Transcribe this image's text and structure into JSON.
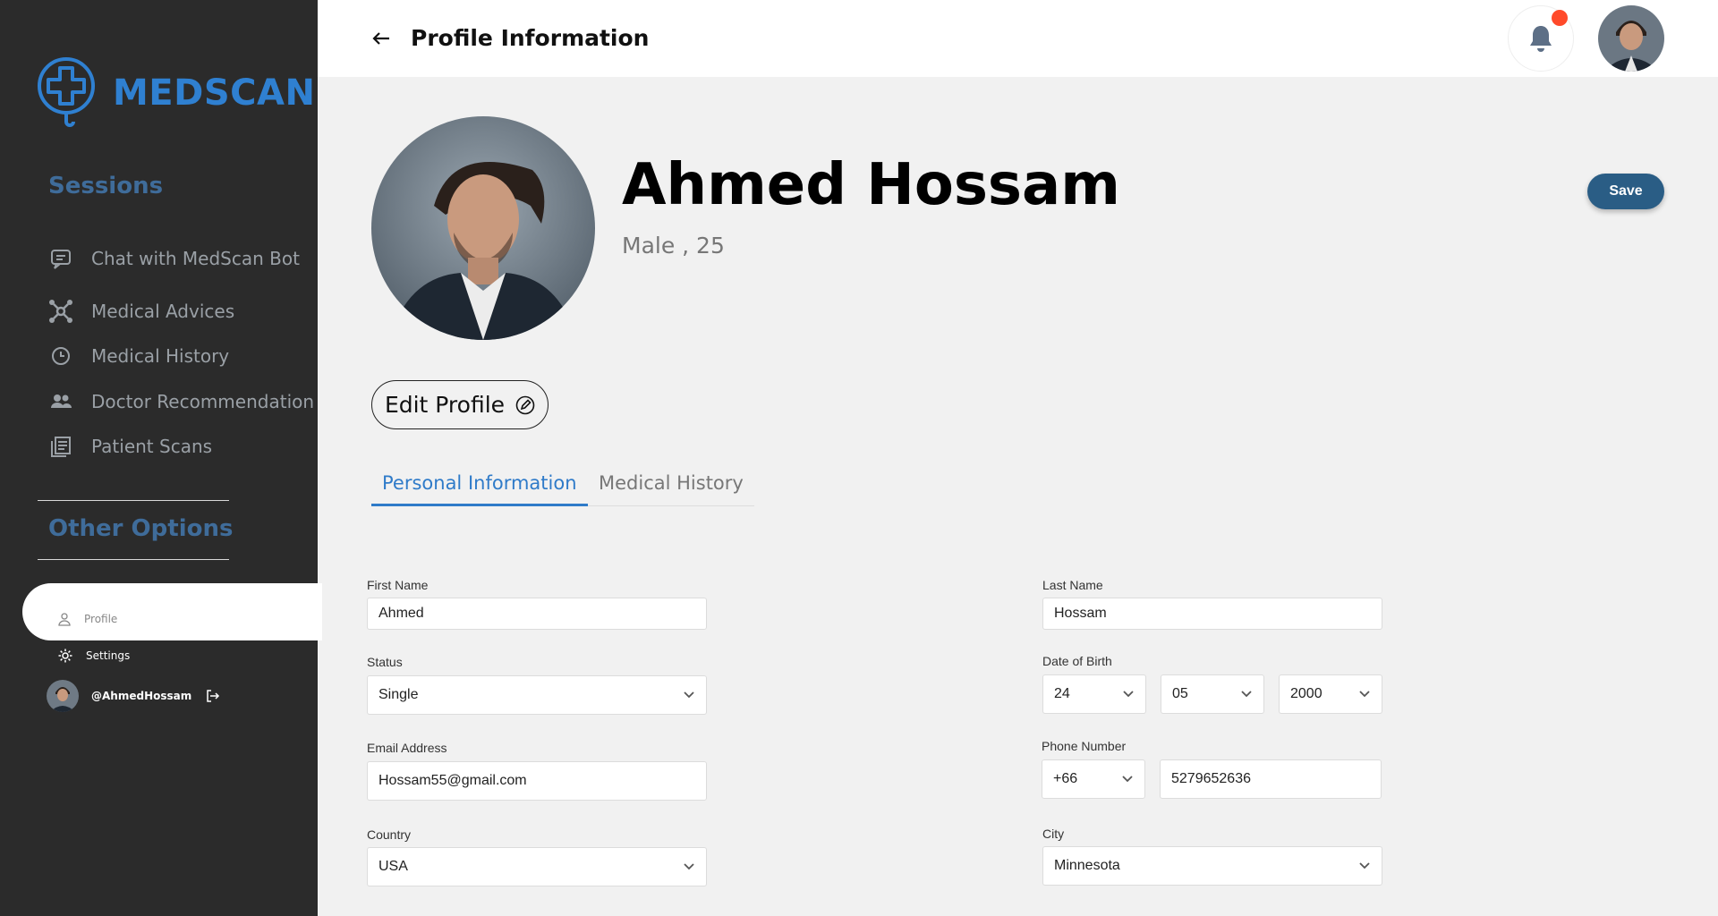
{
  "brand": {
    "name": "MEDSCAN",
    "color": "#2f80d1"
  },
  "sidebar": {
    "sessions_title": "Sessions",
    "items": [
      {
        "label": "Chat with MedScan Bot",
        "icon": "chat-icon"
      },
      {
        "label": "Medical Advices",
        "icon": "network-icon"
      },
      {
        "label": "Medical History",
        "icon": "clock-icon"
      },
      {
        "label": "Doctor Recommendation",
        "icon": "users-icon"
      },
      {
        "label": "Patient Scans",
        "icon": "document-icon"
      }
    ],
    "other_title": "Other Options",
    "other_items": [
      {
        "label": "Profile",
        "icon": "user-icon"
      },
      {
        "label": "Settings",
        "icon": "gear-icon"
      }
    ],
    "username": "@AhmedHossam"
  },
  "header": {
    "title": "Profile Information"
  },
  "profile": {
    "name": "Ahmed Hossam",
    "subtitle": "Male , 25",
    "save_label": "Save",
    "edit_label": "Edit Profile"
  },
  "tabs": [
    {
      "label": "Personal Information",
      "active": true
    },
    {
      "label": "Medical History",
      "active": false
    }
  ],
  "form": {
    "first_name": {
      "label": "First Name",
      "value": "Ahmed"
    },
    "last_name": {
      "label": "Last Name",
      "value": "Hossam"
    },
    "status": {
      "label": "Status",
      "value": "Single"
    },
    "dob": {
      "label": "Date of Birth",
      "day": "24",
      "month": "05",
      "year": "2000"
    },
    "email": {
      "label": "Email Address",
      "value": "Hossam55@gmail.com"
    },
    "phone": {
      "label": "Phone Number",
      "code": "+66",
      "number": "5279652636"
    },
    "country": {
      "label": "Country",
      "value": "USA"
    },
    "city": {
      "label": "City",
      "value": "Minnesota"
    }
  },
  "colors": {
    "accent": "#2f7bc9",
    "save_button": "#2a5d85",
    "notification_dot": "#ff4a2a",
    "sidebar_bg": "#2b2b2b"
  }
}
